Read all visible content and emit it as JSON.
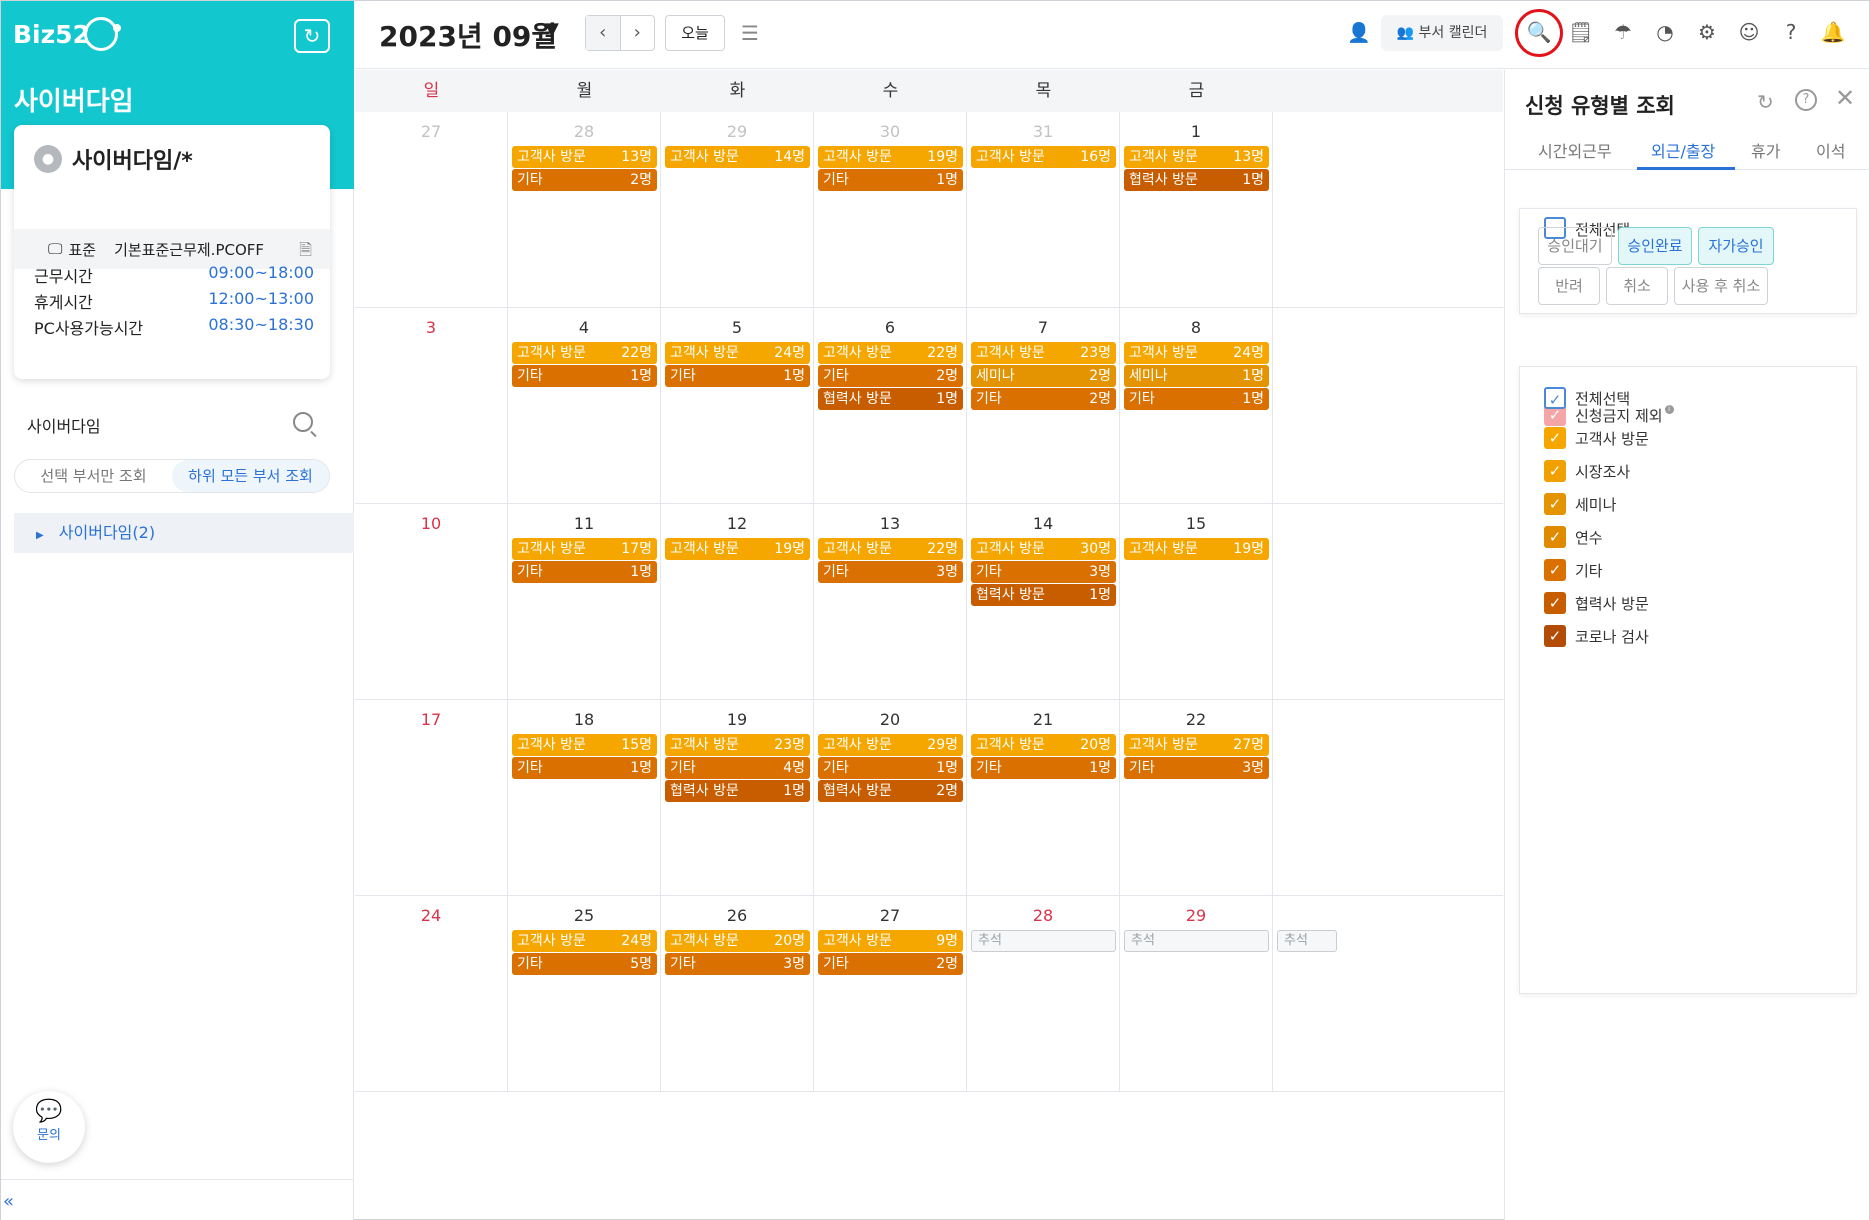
{
  "app": {
    "logo": "Biz52",
    "org_title": "사이버다임"
  },
  "profile": {
    "name": "사이버다임/*",
    "policy_type": "표준",
    "policy_name": "기본표준근무제.PCOFF"
  },
  "times": [
    {
      "label": "근무시간",
      "value": "09:00~18:00"
    },
    {
      "label": "휴게시간",
      "value": "12:00~13:00"
    },
    {
      "label": "PC사용가능시간",
      "value": "08:30~18:30"
    }
  ],
  "dept": {
    "search_label": "사이버다임",
    "scope_options": [
      "선택 부서만 조회",
      "하위 모든 부서 조회"
    ],
    "scope_selected": "하위 모든 부서 조회",
    "tree_item": "사이버다임(2)"
  },
  "inquiry_label": "문의",
  "collapse_label": "«",
  "toolbar": {
    "month": "2023년 09월",
    "today": "오늘",
    "dept_calendar": "부서 캘린더",
    "icons": [
      "search-list-icon",
      "document-icon",
      "umbrella-icon",
      "pie-chart-icon",
      "gear-icon",
      "user-circle-icon",
      "help-icon",
      "bell-icon"
    ]
  },
  "calendar": {
    "weekdays": [
      "일",
      "월",
      "화",
      "수",
      "목",
      "금"
    ],
    "weeks": [
      {
        "days": [
          {
            "d": "27",
            "s": "grey",
            "ev": []
          },
          {
            "d": "28",
            "s": "grey",
            "ev": [
              {
                "t": "고객사 방문",
                "n": "13명",
                "c": "c1"
              },
              {
                "t": "기타",
                "n": "2명",
                "c": "c5"
              }
            ]
          },
          {
            "d": "29",
            "s": "grey",
            "ev": [
              {
                "t": "고객사 방문",
                "n": "14명",
                "c": "c1"
              }
            ]
          },
          {
            "d": "30",
            "s": "grey",
            "ev": [
              {
                "t": "고객사 방문",
                "n": "19명",
                "c": "c1"
              },
              {
                "t": "기타",
                "n": "1명",
                "c": "c5"
              }
            ]
          },
          {
            "d": "31",
            "s": "grey",
            "ev": [
              {
                "t": "고객사 방문",
                "n": "16명",
                "c": "c1"
              }
            ]
          },
          {
            "d": "1",
            "s": "",
            "ev": [
              {
                "t": "고객사 방문",
                "n": "13명",
                "c": "c1"
              },
              {
                "t": "협력사 방문",
                "n": "1명",
                "c": "c6"
              }
            ]
          }
        ]
      },
      {
        "days": [
          {
            "d": "3",
            "s": "red",
            "ev": []
          },
          {
            "d": "4",
            "s": "",
            "ev": [
              {
                "t": "고객사 방문",
                "n": "22명",
                "c": "c1"
              },
              {
                "t": "기타",
                "n": "1명",
                "c": "c5"
              }
            ]
          },
          {
            "d": "5",
            "s": "",
            "ev": [
              {
                "t": "고객사 방문",
                "n": "24명",
                "c": "c1"
              },
              {
                "t": "기타",
                "n": "1명",
                "c": "c5"
              }
            ]
          },
          {
            "d": "6",
            "s": "",
            "ev": [
              {
                "t": "고객사 방문",
                "n": "22명",
                "c": "c1"
              },
              {
                "t": "기타",
                "n": "2명",
                "c": "c5"
              },
              {
                "t": "협력사 방문",
                "n": "1명",
                "c": "c6"
              }
            ]
          },
          {
            "d": "7",
            "s": "",
            "ev": [
              {
                "t": "고객사 방문",
                "n": "23명",
                "c": "c1"
              },
              {
                "t": "세미나",
                "n": "2명",
                "c": "c3"
              },
              {
                "t": "기타",
                "n": "2명",
                "c": "c5"
              }
            ]
          },
          {
            "d": "8",
            "s": "",
            "ev": [
              {
                "t": "고객사 방문",
                "n": "24명",
                "c": "c1"
              },
              {
                "t": "세미나",
                "n": "1명",
                "c": "c3"
              },
              {
                "t": "기타",
                "n": "1명",
                "c": "c5"
              }
            ]
          }
        ]
      },
      {
        "days": [
          {
            "d": "10",
            "s": "red",
            "ev": []
          },
          {
            "d": "11",
            "s": "",
            "ev": [
              {
                "t": "고객사 방문",
                "n": "17명",
                "c": "c1"
              },
              {
                "t": "기타",
                "n": "1명",
                "c": "c5"
              }
            ]
          },
          {
            "d": "12",
            "s": "",
            "ev": [
              {
                "t": "고객사 방문",
                "n": "19명",
                "c": "c1"
              }
            ]
          },
          {
            "d": "13",
            "s": "",
            "ev": [
              {
                "t": "고객사 방문",
                "n": "22명",
                "c": "c1"
              },
              {
                "t": "기타",
                "n": "3명",
                "c": "c5"
              }
            ]
          },
          {
            "d": "14",
            "s": "",
            "ev": [
              {
                "t": "고객사 방문",
                "n": "30명",
                "c": "c1"
              },
              {
                "t": "기타",
                "n": "3명",
                "c": "c5"
              },
              {
                "t": "협력사 방문",
                "n": "1명",
                "c": "c6"
              }
            ]
          },
          {
            "d": "15",
            "s": "",
            "ev": [
              {
                "t": "고객사 방문",
                "n": "19명",
                "c": "c1"
              }
            ]
          }
        ]
      },
      {
        "days": [
          {
            "d": "17",
            "s": "red",
            "ev": []
          },
          {
            "d": "18",
            "s": "",
            "ev": [
              {
                "t": "고객사 방문",
                "n": "15명",
                "c": "c1"
              },
              {
                "t": "기타",
                "n": "1명",
                "c": "c5"
              }
            ]
          },
          {
            "d": "19",
            "s": "",
            "ev": [
              {
                "t": "고객사 방문",
                "n": "23명",
                "c": "c1"
              },
              {
                "t": "기타",
                "n": "4명",
                "c": "c5"
              },
              {
                "t": "협력사 방문",
                "n": "1명",
                "c": "c6"
              }
            ]
          },
          {
            "d": "20",
            "s": "",
            "ev": [
              {
                "t": "고객사 방문",
                "n": "29명",
                "c": "c1"
              },
              {
                "t": "기타",
                "n": "1명",
                "c": "c5"
              },
              {
                "t": "협력사 방문",
                "n": "2명",
                "c": "c6"
              }
            ]
          },
          {
            "d": "21",
            "s": "",
            "ev": [
              {
                "t": "고객사 방문",
                "n": "20명",
                "c": "c1"
              },
              {
                "t": "기타",
                "n": "1명",
                "c": "c5"
              }
            ]
          },
          {
            "d": "22",
            "s": "",
            "ev": [
              {
                "t": "고객사 방문",
                "n": "27명",
                "c": "c1"
              },
              {
                "t": "기타",
                "n": "3명",
                "c": "c5"
              }
            ]
          }
        ]
      },
      {
        "days": [
          {
            "d": "24",
            "s": "red",
            "ev": []
          },
          {
            "d": "25",
            "s": "",
            "ev": [
              {
                "t": "고객사 방문",
                "n": "24명",
                "c": "c1"
              },
              {
                "t": "기타",
                "n": "5명",
                "c": "c5"
              }
            ]
          },
          {
            "d": "26",
            "s": "",
            "ev": [
              {
                "t": "고객사 방문",
                "n": "20명",
                "c": "c1"
              },
              {
                "t": "기타",
                "n": "3명",
                "c": "c5"
              }
            ]
          },
          {
            "d": "27",
            "s": "",
            "ev": [
              {
                "t": "고객사 방문",
                "n": "9명",
                "c": "c1"
              },
              {
                "t": "기타",
                "n": "2명",
                "c": "c5"
              }
            ]
          },
          {
            "d": "28",
            "s": "red",
            "holiday": "추석",
            "ev": []
          },
          {
            "d": "29",
            "s": "red",
            "holiday": "추석",
            "ev": []
          }
        ]
      }
    ],
    "overflow_holiday": "추석"
  },
  "colors": {
    "c1": "#f5a700",
    "c2": "#f0a000",
    "c3": "#e39400",
    "c4": "#e08a00",
    "c5": "#d97000",
    "c6": "#c85d00",
    "c7": "#b34c06",
    "accent": "#2b72d6",
    "teal": "#13c7cf",
    "sunday": "#d9334a"
  },
  "panel": {
    "title": "신청 유형별 조회",
    "tabs": [
      "시간외근무",
      "외근/출장",
      "휴가",
      "이석"
    ],
    "active_tab": "외근/출장",
    "select_all": "전체선택",
    "status_chips": [
      {
        "label": "승인대기",
        "on": false
      },
      {
        "label": "승인완료",
        "on": true
      },
      {
        "label": "자가승인",
        "on": true
      },
      {
        "label": "반려",
        "on": false
      },
      {
        "label": "취소",
        "on": false
      },
      {
        "label": "사용 후 취소",
        "on": false
      }
    ],
    "exclude_label": "신청금지 제외",
    "type_select_all": "전체선택",
    "types": [
      {
        "label": "고객사 방문",
        "color": "c1"
      },
      {
        "label": "시장조사",
        "color": "c2"
      },
      {
        "label": "세미나",
        "color": "c3"
      },
      {
        "label": "연수",
        "color": "c4"
      },
      {
        "label": "기타",
        "color": "c5"
      },
      {
        "label": "협력사 방문",
        "color": "c6"
      },
      {
        "label": "코로나 검사",
        "color": "c7"
      }
    ]
  }
}
